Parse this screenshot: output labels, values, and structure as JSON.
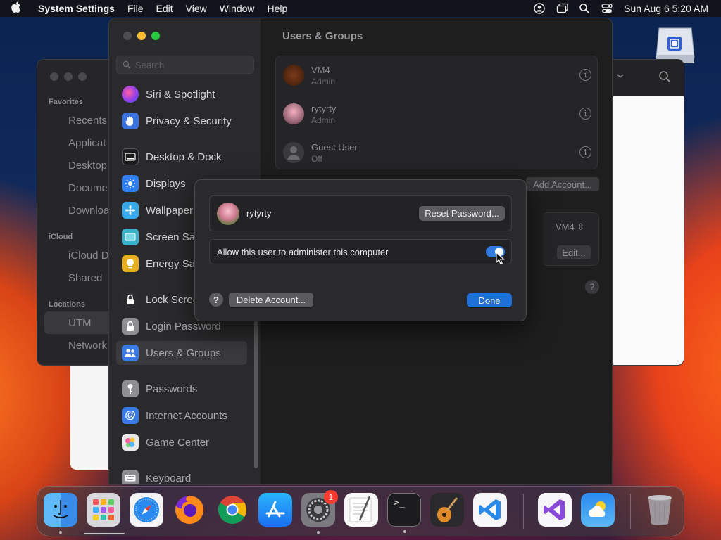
{
  "menubar": {
    "app_name": "System Settings",
    "menus": [
      "File",
      "Edit",
      "View",
      "Window",
      "Help"
    ],
    "clock": "Sun Aug 6  5:20 AM"
  },
  "finder": {
    "sections": {
      "favorites": "Favorites",
      "icloud": "iCloud",
      "locations": "Locations"
    },
    "items": {
      "recents": "Recents",
      "applications": "Applicat",
      "desktop": "Desktop",
      "documents": "Docume",
      "downloads": "Downloa",
      "icloud_drive": "iCloud D",
      "shared": "Shared",
      "utm": "UTM",
      "network": "Network"
    }
  },
  "settings": {
    "search_placeholder": "Search",
    "sidebar": [
      {
        "label": "Siri & Spotlight",
        "icon": "siri-icon",
        "color": "#b13fd8"
      },
      {
        "label": "Privacy & Security",
        "icon": "hand-icon",
        "color": "#3a72e0"
      },
      {
        "label": "Desktop & Dock",
        "icon": "dock-icon",
        "color": "#1c1c1e"
      },
      {
        "label": "Displays",
        "icon": "sun-icon",
        "color": "#2f7ff0"
      },
      {
        "label": "Wallpaper",
        "icon": "wallpaper-icon",
        "color": "#39a8e8"
      },
      {
        "label": "Screen Sa",
        "icon": "screensaver-icon",
        "color": "#3bb0c8"
      },
      {
        "label": "Energy Sa",
        "icon": "bulb-icon",
        "color": "#e8b020"
      },
      {
        "label": "Lock Scree",
        "icon": "lock-icon",
        "color": "#2c2c2e"
      },
      {
        "label": "Login Password",
        "icon": "login-lock-icon",
        "color": "#8e8e93"
      },
      {
        "label": "Users & Groups",
        "icon": "users-icon",
        "color": "#3a7ae8"
      },
      {
        "label": "Passwords",
        "icon": "key-icon",
        "color": "#8e8e93"
      },
      {
        "label": "Internet Accounts",
        "icon": "at-icon",
        "color": "#3a7ae8"
      },
      {
        "label": "Game Center",
        "icon": "gamecenter-icon",
        "color": "#e8e8e8"
      },
      {
        "label": "Keyboard",
        "icon": "keyboard-icon",
        "color": "#8e8e93"
      }
    ],
    "main": {
      "title": "Users & Groups",
      "users": [
        {
          "name": "VM4",
          "role": "Admin"
        },
        {
          "name": "rytyrty",
          "role": "Admin"
        },
        {
          "name": "Guest User",
          "role": "Off"
        }
      ],
      "info_glyph": "i",
      "add_account": "Add Account...",
      "auto_login_value": "VM4",
      "edit_label": "Edit...",
      "help_glyph": "?"
    }
  },
  "dialog": {
    "user_name": "rytyrty",
    "reset_password": "Reset Password...",
    "admin_label": "Allow this user to administer this computer",
    "admin_enabled": true,
    "help_glyph": "?",
    "delete_account": "Delete Account...",
    "done": "Done"
  },
  "dock": {
    "system_settings_badge": "1",
    "apps": [
      "finder-icon",
      "launchpad-icon",
      "safari-icon",
      "firefox-icon",
      "chrome-icon",
      "app-store-icon",
      "system-settings-icon",
      "textedit-icon",
      "terminal-icon",
      "garageband-icon",
      "vscode-icon",
      "visual-studio-icon",
      "weather-icon",
      "trash-icon"
    ]
  },
  "colors": {
    "accent": "#1f6fd8",
    "toggle_on": "#2f79e0",
    "badge": "#ff3b30"
  }
}
